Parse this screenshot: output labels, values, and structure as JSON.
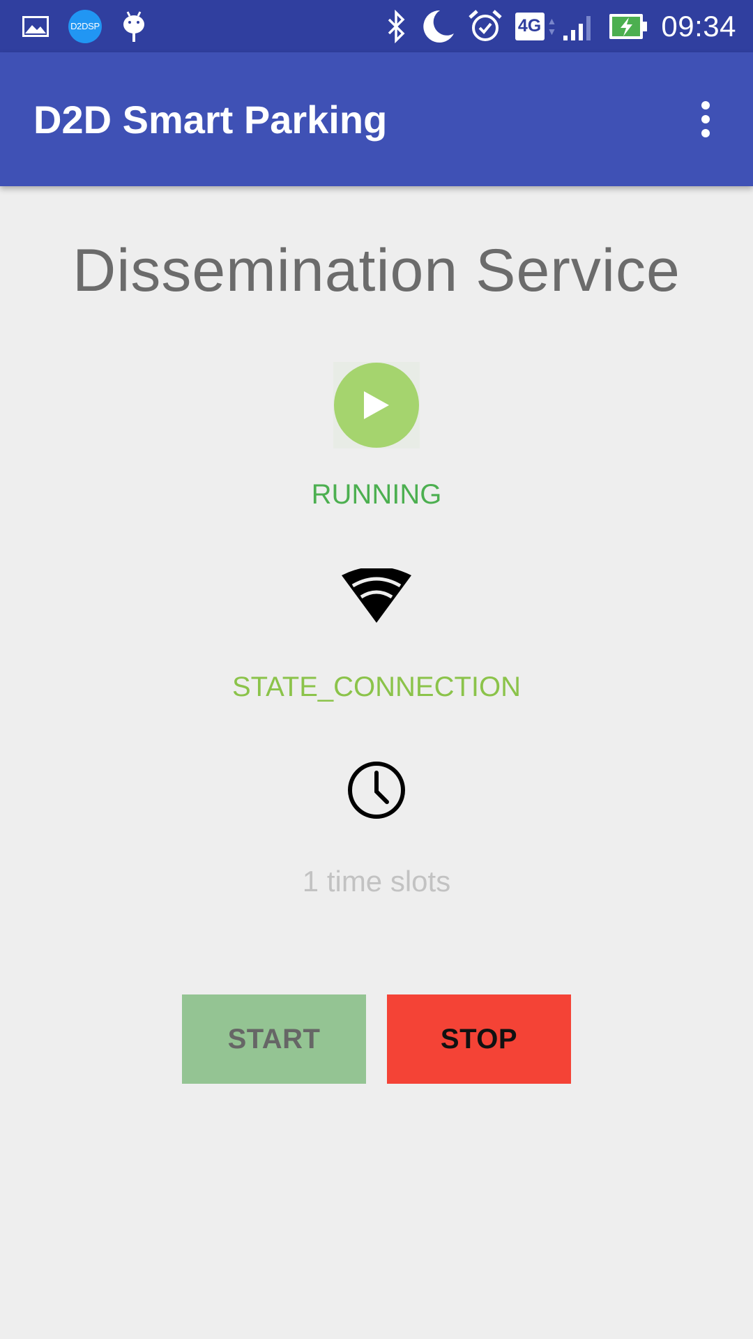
{
  "status_bar": {
    "left_icons": [
      {
        "name": "gallery-icon"
      },
      {
        "name": "d2dsp-app-icon",
        "label": "D2DSP"
      },
      {
        "name": "android-debug-icon"
      }
    ],
    "right_icons": [
      {
        "name": "bluetooth-icon"
      },
      {
        "name": "do-not-disturb-moon-icon"
      },
      {
        "name": "alarm-icon"
      },
      {
        "name": "network-4g-icon",
        "label": "4G"
      },
      {
        "name": "cell-signal-icon"
      },
      {
        "name": "battery-charging-icon"
      }
    ],
    "time": "09:34"
  },
  "app_bar": {
    "title": "D2D Smart Parking",
    "overflow_icon": "more-vert-icon"
  },
  "main": {
    "headline": "Dissemination Service",
    "service_icon": "play-icon",
    "service_status": "RUNNING",
    "connection_icon": "wifi-icon",
    "connection_state": "STATE_CONNECTION",
    "timer_icon": "clock-icon",
    "time_slots": "1 time slots",
    "start_label": "START",
    "stop_label": "STOP"
  },
  "colors": {
    "status_bar": "#303f9f",
    "app_bar": "#3f51b5",
    "background": "#eeeeee",
    "running_green": "#4caf50",
    "connection_green": "#8bc34a",
    "play_circle": "#a5d46e",
    "start_button": "#94c493",
    "stop_button": "#f44336"
  }
}
